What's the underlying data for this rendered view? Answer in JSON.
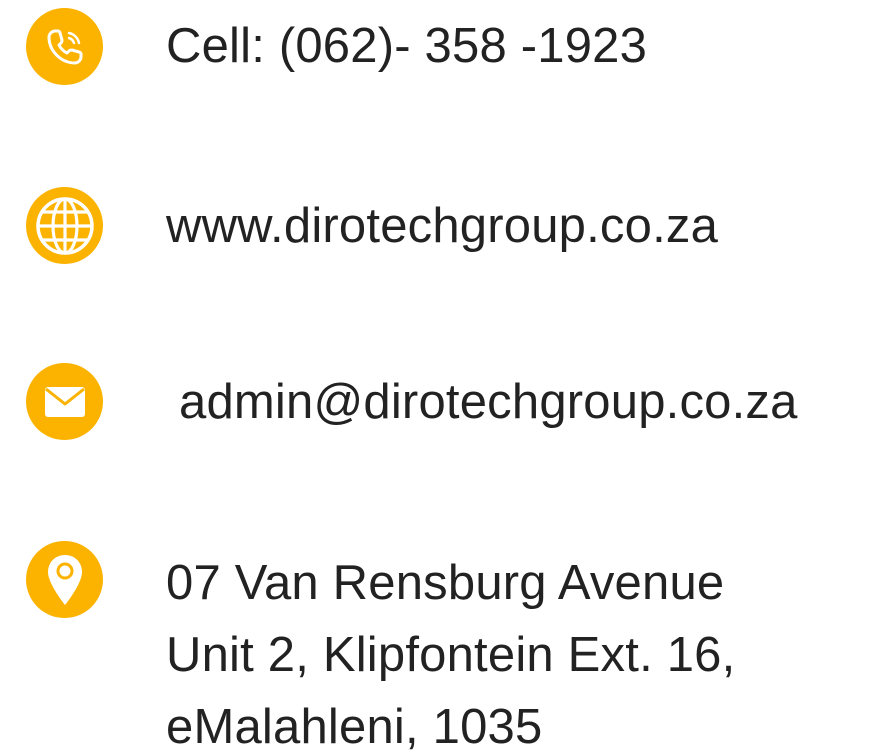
{
  "colors": {
    "icon_circle": "#FBB300",
    "icon_glyph": "#FFFFFF",
    "text": "#222222",
    "background": "#FFFFFF"
  },
  "contacts": {
    "phone": {
      "icon": "phone-icon",
      "text": "Cell: (062)- 358 -1923"
    },
    "website": {
      "icon": "globe-icon",
      "text": "www.dirotechgroup.co.za"
    },
    "email": {
      "icon": "envelope-icon",
      "text": "admin@dirotechgroup.co.za"
    },
    "address": {
      "icon": "location-pin-icon",
      "lines": [
        "07 Van Rensburg Avenue",
        "Unit 2, Klipfontein Ext. 16,",
        "eMalahleni, 1035"
      ]
    }
  }
}
